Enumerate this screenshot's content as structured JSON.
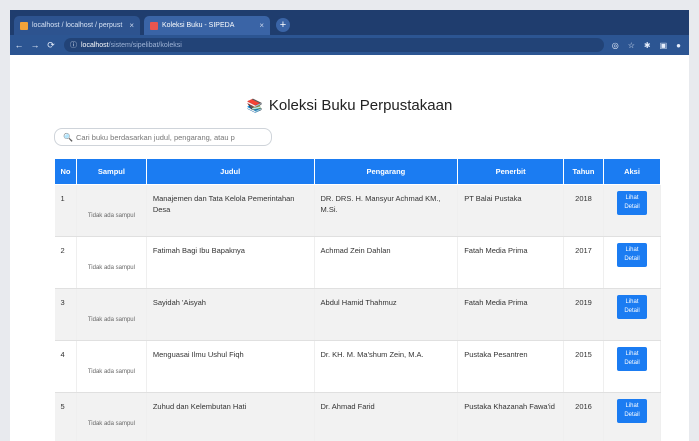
{
  "browser": {
    "tabs": [
      {
        "label": "localhost / localhost / perpust",
        "active": false
      },
      {
        "label": "Koleksi Buku - SIPEDA",
        "active": true
      }
    ],
    "url_host": "localhost",
    "url_path": "/sistem/sipelibat/koleksi"
  },
  "page": {
    "title": "Koleksi Buku Perpustakaan",
    "search_placeholder": "Cari buku berdasarkan judul, pengarang, atau p"
  },
  "table": {
    "headers": [
      "No",
      "Sampul",
      "Judul",
      "Pengarang",
      "Penerbit",
      "Tahun",
      "Aksi"
    ],
    "rows": [
      {
        "no": "1",
        "cover": "Tidak ada sampul",
        "title": "Manajemen dan Tata Kelola Pemerintahan Desa",
        "author": "DR. DRS. H. Mansyur Achmad KM., M.Si.",
        "publisher": "PT Balai Pustaka",
        "year": "2018",
        "action": "Lihat Detail"
      },
      {
        "no": "2",
        "cover": "Tidak ada sampul",
        "title": "Fatimah Bagi Ibu Bapaknya",
        "author": "Achmad Zein Dahlan",
        "publisher": "Fatah Media Prima",
        "year": "2017",
        "action": "Lihat Detail"
      },
      {
        "no": "3",
        "cover": "Tidak ada sampul",
        "title": "Sayidah 'Aisyah",
        "author": "Abdul Hamid Thahmuz",
        "publisher": "Fatah Media Prima",
        "year": "2019",
        "action": "Lihat Detail"
      },
      {
        "no": "4",
        "cover": "Tidak ada sampul",
        "title": "Menguasai Ilmu Ushul Fiqh",
        "author": "Dr. KH. M. Ma'shum Zein, M.A.",
        "publisher": "Pustaka Pesantren",
        "year": "2015",
        "action": "Lihat Detail"
      },
      {
        "no": "5",
        "cover": "Tidak ada sampul",
        "title": "Zuhud dan Kelembutan Hati",
        "author": "Dr. Ahmad Farid",
        "publisher": "Pustaka Khazanah Fawa'id",
        "year": "2016",
        "action": "Lihat Detail"
      }
    ]
  },
  "colors": {
    "accent": "#1b7cf2",
    "tabbar": "#1f3d6e"
  }
}
